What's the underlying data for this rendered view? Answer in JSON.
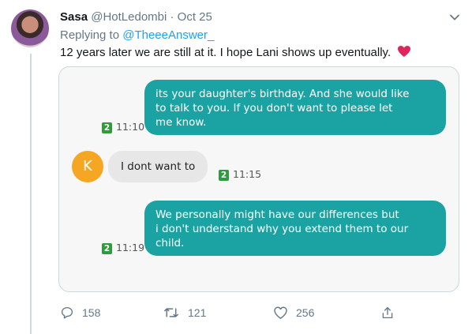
{
  "tweet": {
    "author_name": "Sasa",
    "author_handle": "@HotLedombi",
    "separator": "·",
    "date": "Oct 25",
    "replying_prefix": "Replying to",
    "replying_to": "@TheeeAnswer_",
    "text": "12 years later we are still at it. I hope Lani shows up eventually.",
    "emoji": "red-heart"
  },
  "chat": {
    "messages": [
      {
        "direction": "outgoing",
        "lines": [
          "its your daughter's birthday. And she would like",
          "to talk to you. If you don't want to please let",
          "me know."
        ],
        "badge": "2",
        "time": "11:10"
      },
      {
        "direction": "incoming",
        "sender_initial": "K",
        "text": "I dont want to",
        "badge": "2",
        "time": "11:15"
      },
      {
        "direction": "outgoing",
        "lines": [
          "We personally might have our differences but",
          "i don't understand why you extend them to our",
          "child."
        ],
        "badge": "2",
        "time": "11:19"
      }
    ],
    "colors": {
      "outgoing_bubble": "#1ba3a3",
      "incoming_bubble": "#e7e7e7",
      "badge": "#2e9c3c",
      "sender_avatar": "#f5a623"
    }
  },
  "actions": {
    "reply_count": "158",
    "retweet_count": "121",
    "like_count": "256"
  },
  "colors": {
    "accent": "#1da1f2",
    "muted": "#657786",
    "heart": "#e0245e"
  }
}
